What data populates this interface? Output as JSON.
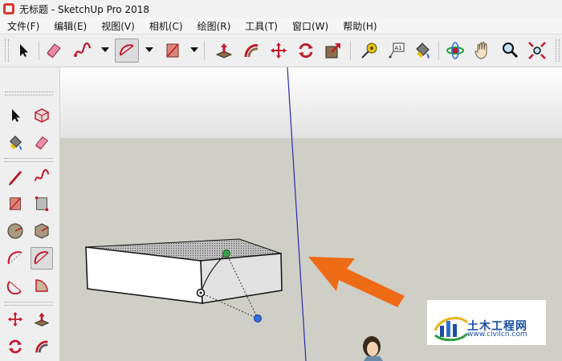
{
  "window": {
    "title": "无标题 - SketchUp Pro 2018"
  },
  "menu": [
    "文件(F)",
    "编辑(E)",
    "视图(V)",
    "相机(C)",
    "绘图(R)",
    "工具(T)",
    "窗口(W)",
    "帮助(H)"
  ],
  "toolbar": {
    "tools": [
      "select",
      "eraser",
      "freehand",
      "arc",
      "rectangle",
      "push-pull",
      "follow-me",
      "move",
      "rotate",
      "scale",
      "tape-measure",
      "text",
      "paint-bucket",
      "orbit",
      "pan",
      "zoom",
      "zoom-extents"
    ],
    "active_tool": "arc"
  },
  "left_toolbar": {
    "tools": [
      "select",
      "make-component",
      "paint-bucket",
      "eraser",
      "line",
      "freehand",
      "rectangle",
      "rotated-rectangle",
      "circle",
      "polygon",
      "arc-2pt",
      "arc-center",
      "arc-3pt",
      "pie",
      "move",
      "push-pull",
      "rotate",
      "follow-me"
    ],
    "active_tool": "arc-center"
  },
  "watermark": {
    "name": "土木工程网",
    "url": "www.civilcn.com"
  },
  "colors": {
    "axis_blue": "#2a2aa8",
    "arrow_orange": "#ef6a14",
    "point_green": "#3aa04a",
    "point_blue": "#2f6fe0"
  }
}
